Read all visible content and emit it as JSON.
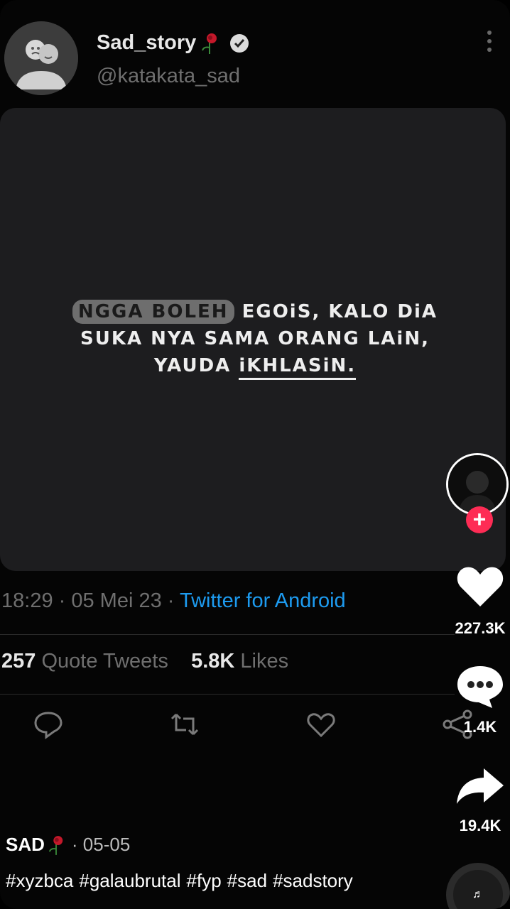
{
  "tweet": {
    "author_name": "Sad_story",
    "author_handle": "@katakata_sad",
    "quote_lines": {
      "l1_highlight": "NGGA BOLEH",
      "l1_rest": " EGOiS, KALO DiA",
      "l2": "SUKA NYA SAMA ORANG LAiN,",
      "l3_pre": "YAUDA ",
      "l3_underlined": "iKHLASiN."
    },
    "time": "18:29",
    "date": "05 Mei 23",
    "source": "Twitter for Android",
    "quote_tweets_count": "257",
    "quote_tweets_label": "Quote Tweets",
    "likes_count": "5.8K",
    "likes_label": "Likes"
  },
  "rail": {
    "likes": "227.3K",
    "comments": "1.4K",
    "shares": "19.4K"
  },
  "caption": {
    "username": "SAD",
    "date": "05-05",
    "hashtags": [
      "#xyzbca",
      "#galaubrutal",
      "#fyp",
      "#sad",
      "#sadstory"
    ]
  },
  "colors": {
    "accent_blue": "#1d9bf0",
    "follow_red": "#fe2c55"
  },
  "icons": [
    "people-avatar-icon",
    "rose-emoji-icon",
    "verified-badge-icon",
    "more-vertical-icon",
    "reply-icon",
    "retweet-icon",
    "like-outline-icon",
    "share-icon",
    "heart-icon",
    "comment-icon",
    "share-arrow-icon",
    "music-note-icon"
  ]
}
